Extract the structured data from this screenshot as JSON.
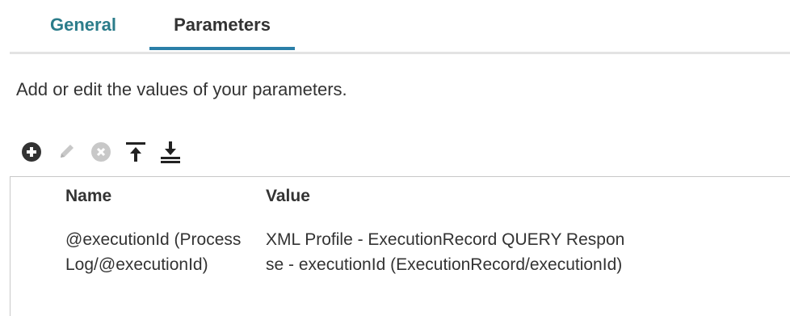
{
  "tabs": {
    "general": "General",
    "parameters": "Parameters"
  },
  "description": "Add or edit the values of your parameters.",
  "toolbar": {
    "icons": [
      "add-icon",
      "edit-icon",
      "remove-icon",
      "move-to-top-icon",
      "move-to-bottom-icon"
    ]
  },
  "table": {
    "headers": {
      "name": "Name",
      "value": "Value"
    },
    "rows": [
      {
        "name": "@executionId (ProcessLog/@executionId)",
        "value": "XML Profile - ExecutionRecord QUERY Response - executionId (ExecutionRecord/executionId)"
      }
    ]
  },
  "colors": {
    "tab_general": "#2b7c8a",
    "tab_underline": "#2a7fa8",
    "text": "#333333",
    "divider": "#e3e3e3"
  }
}
